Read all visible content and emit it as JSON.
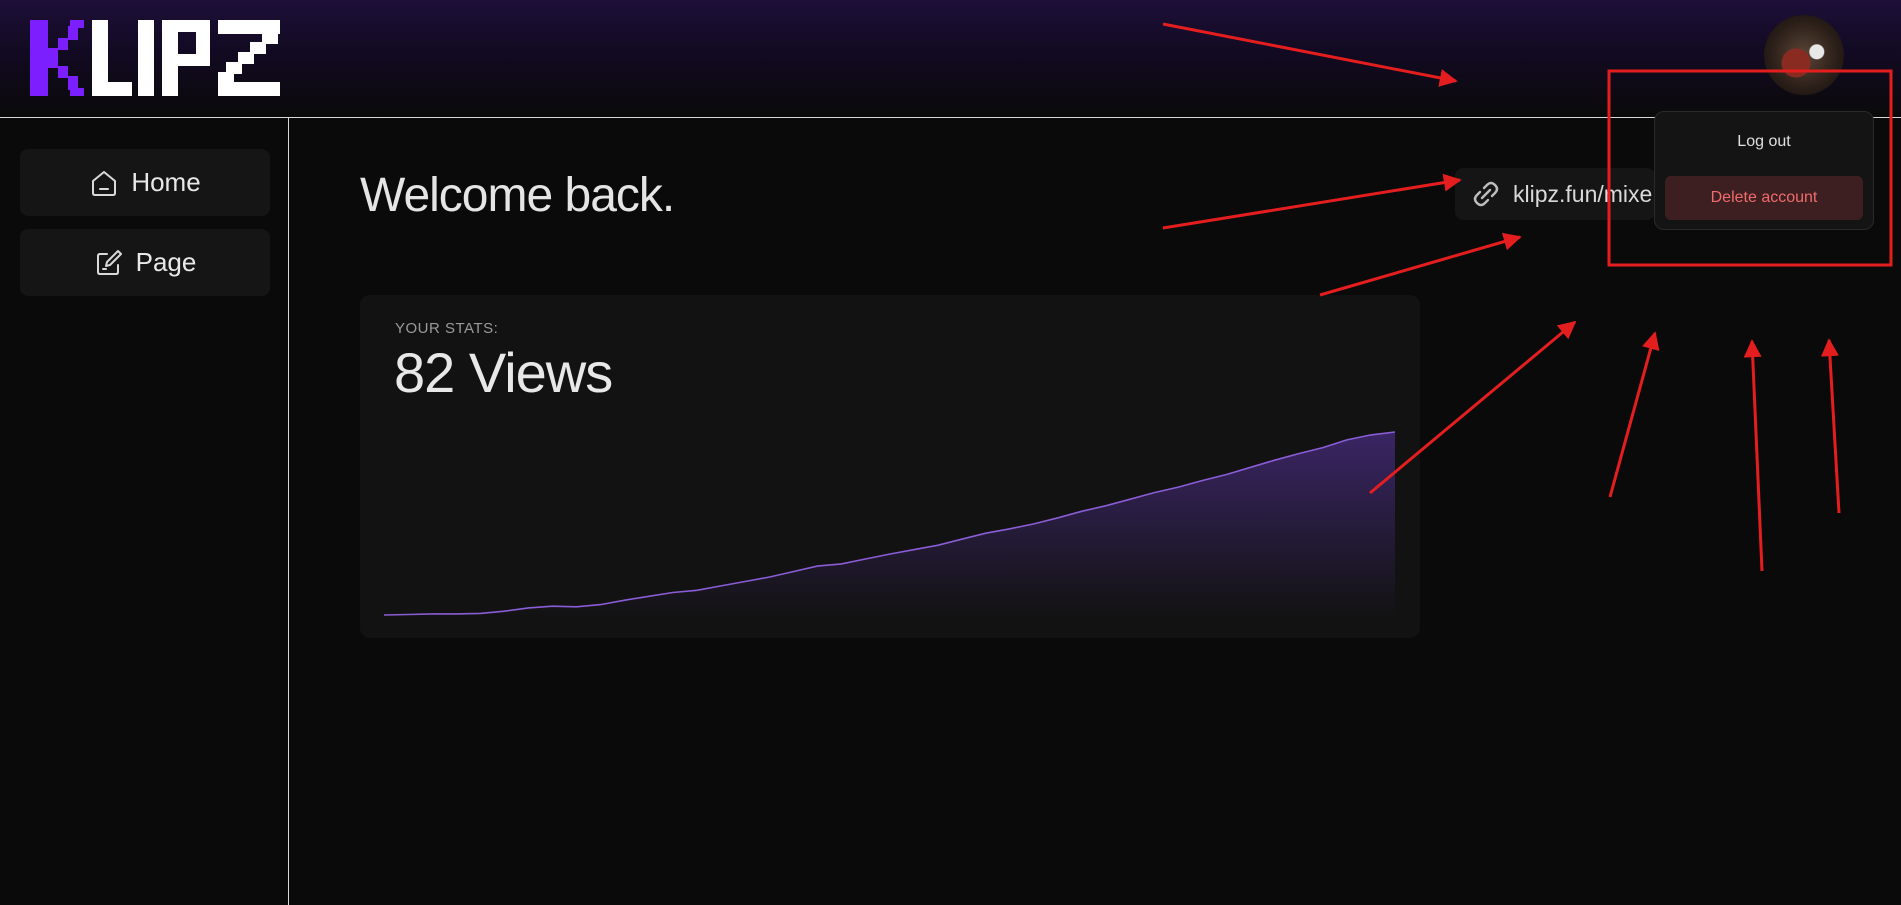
{
  "brand": {
    "logo_text": "KLIPZ",
    "accent_color": "#7b1fff"
  },
  "sidebar": {
    "items": [
      {
        "label": "Home",
        "icon": "home-icon"
      },
      {
        "label": "Page",
        "icon": "edit-page-icon"
      }
    ]
  },
  "main": {
    "title": "Welcome back.",
    "link": {
      "text": "klipz.fun/mixe",
      "icon": "link-icon"
    }
  },
  "stats": {
    "label": "YOUR STATS:",
    "value": "82 Views",
    "line_color": "#8a5cd6"
  },
  "chart_data": {
    "type": "area",
    "title": "",
    "xlabel": "",
    "ylabel": "",
    "values": [
      0,
      0.3,
      0.6,
      0.6,
      0.9,
      2.1,
      3.9,
      4.8,
      4.5,
      5.7,
      8.1,
      10.2,
      12.3,
      13.5,
      15.9,
      18.3,
      20.7,
      23.7,
      26.7,
      27.9,
      30.6,
      33.3,
      35.7,
      38.1,
      41.4,
      44.7,
      47.1,
      49.8,
      53.1,
      56.7,
      59.7,
      63.3,
      66.9,
      69.9,
      73.5,
      76.8,
      80.7,
      84.6,
      88.2,
      91.5,
      95.7,
      98.4,
      100
    ],
    "ylim": [
      0,
      100
    ],
    "grid": false
  },
  "account_menu": {
    "logout_label": "Log out",
    "delete_label": "Delete account",
    "delete_color": "#f06b6b"
  }
}
